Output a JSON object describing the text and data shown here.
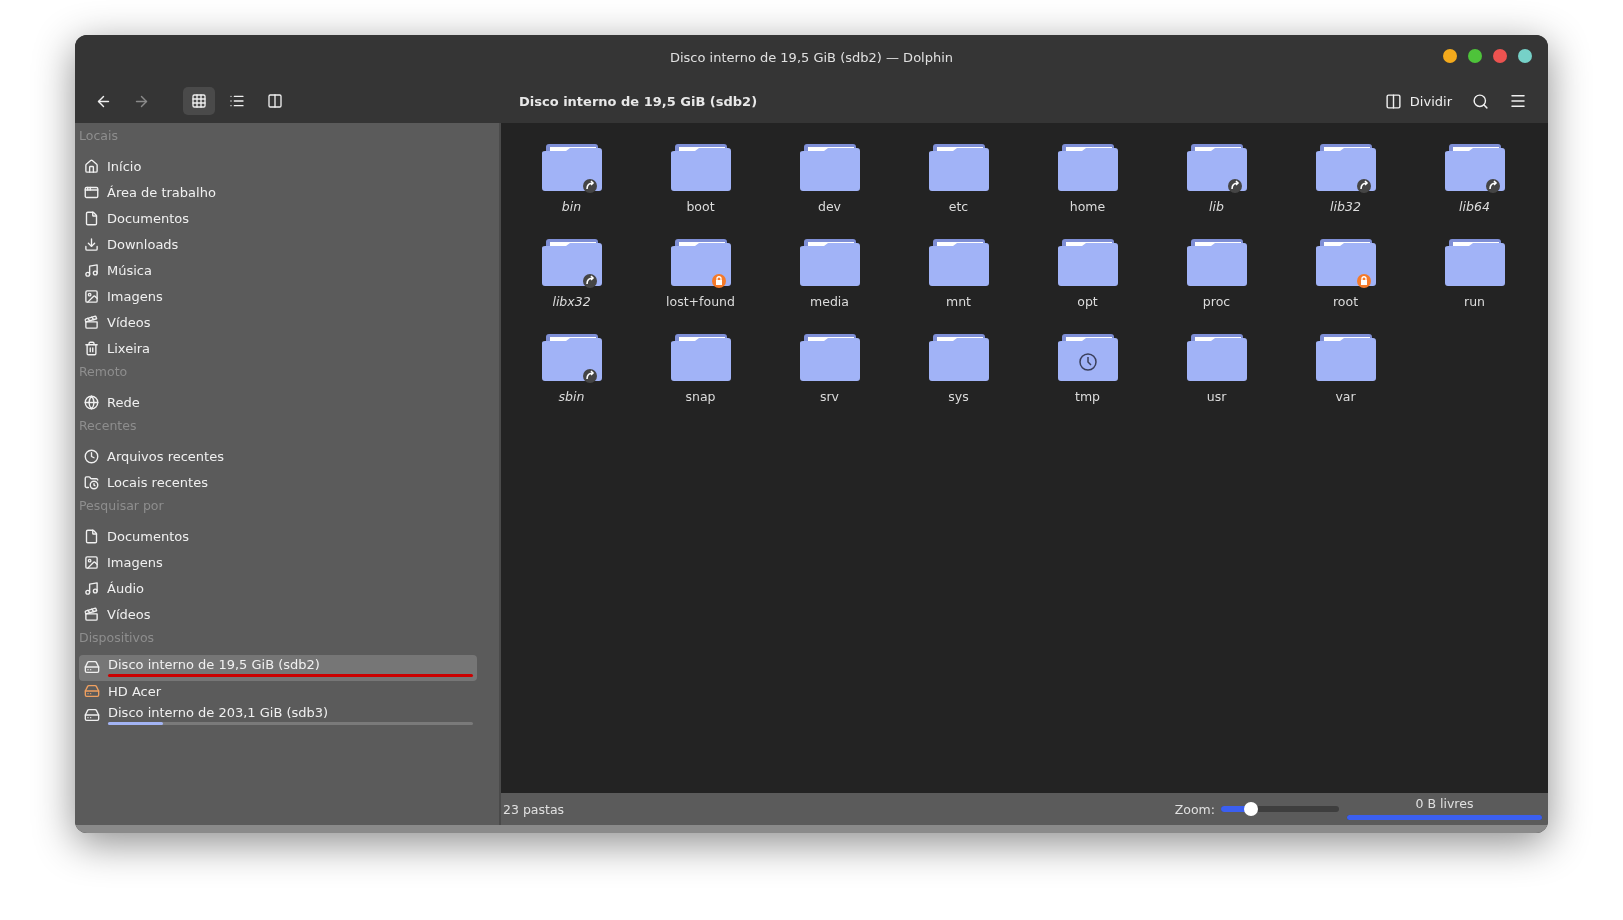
{
  "window": {
    "title": "Disco interno de 19,5 GiB (sdb2) — Dolphin"
  },
  "toolbar": {
    "view_modes": [
      {
        "kind": "icons",
        "selected": true
      },
      {
        "kind": "details",
        "selected": false
      },
      {
        "kind": "tree",
        "selected": false
      }
    ],
    "location": "Disco interno de 19,5 GiB (sdb2)",
    "split_label": "Dividir"
  },
  "sidebar": {
    "sections": [
      {
        "title": "Locais",
        "items": [
          {
            "kind": "home",
            "label": "Início"
          },
          {
            "kind": "desktop",
            "label": "Área de trabalho"
          },
          {
            "kind": "document",
            "label": "Documentos"
          },
          {
            "kind": "download",
            "label": "Downloads"
          },
          {
            "kind": "music",
            "label": "Música"
          },
          {
            "kind": "image",
            "label": "Imagens"
          },
          {
            "kind": "video",
            "label": "Vídeos"
          },
          {
            "kind": "trash",
            "label": "Lixeira"
          }
        ]
      },
      {
        "title": "Remoto",
        "items": [
          {
            "kind": "network",
            "label": "Rede"
          }
        ]
      },
      {
        "title": "Recentes",
        "items": [
          {
            "kind": "recent-files",
            "label": "Arquivos recentes"
          },
          {
            "kind": "recent-places",
            "label": "Locais recentes"
          }
        ]
      },
      {
        "title": "Pesquisar por",
        "items": [
          {
            "kind": "document",
            "label": "Documentos"
          },
          {
            "kind": "image",
            "label": "Imagens"
          },
          {
            "kind": "music",
            "label": "Áudio"
          },
          {
            "kind": "video",
            "label": "Vídeos"
          }
        ]
      }
    ],
    "devices_title": "Dispositivos",
    "devices": [
      {
        "label": "Disco interno de 19,5 GiB (sdb2)",
        "selected": true,
        "mounted": true,
        "level": 1.0
      },
      {
        "label": "HD Acer",
        "selected": false,
        "mounted": false
      },
      {
        "label": "Disco interno de 203,1 GiB (sdb3)",
        "selected": false,
        "mounted": true,
        "level": 0.15
      }
    ]
  },
  "folders": [
    {
      "name": "bin",
      "kind": "link"
    },
    {
      "name": "boot",
      "kind": "plain"
    },
    {
      "name": "dev",
      "kind": "plain"
    },
    {
      "name": "etc",
      "kind": "plain"
    },
    {
      "name": "home",
      "kind": "plain"
    },
    {
      "name": "lib",
      "kind": "link"
    },
    {
      "name": "lib32",
      "kind": "link"
    },
    {
      "name": "lib64",
      "kind": "link"
    },
    {
      "name": "libx32",
      "kind": "link"
    },
    {
      "name": "lost+found",
      "kind": "locked"
    },
    {
      "name": "media",
      "kind": "plain"
    },
    {
      "name": "mnt",
      "kind": "plain"
    },
    {
      "name": "opt",
      "kind": "plain"
    },
    {
      "name": "proc",
      "kind": "plain"
    },
    {
      "name": "root",
      "kind": "locked"
    },
    {
      "name": "run",
      "kind": "plain"
    },
    {
      "name": "sbin",
      "kind": "link"
    },
    {
      "name": "snap",
      "kind": "plain"
    },
    {
      "name": "srv",
      "kind": "plain"
    },
    {
      "name": "sys",
      "kind": "plain"
    },
    {
      "name": "tmp",
      "kind": "temp"
    },
    {
      "name": "usr",
      "kind": "plain"
    },
    {
      "name": "var",
      "kind": "plain"
    }
  ],
  "status_bar": {
    "count": "23 pastas",
    "zoom_label": "Zoom:",
    "zoom": {
      "level": 0.25
    },
    "free_space": "0 B livres",
    "free_bar": {
      "level": 1.0
    }
  }
}
